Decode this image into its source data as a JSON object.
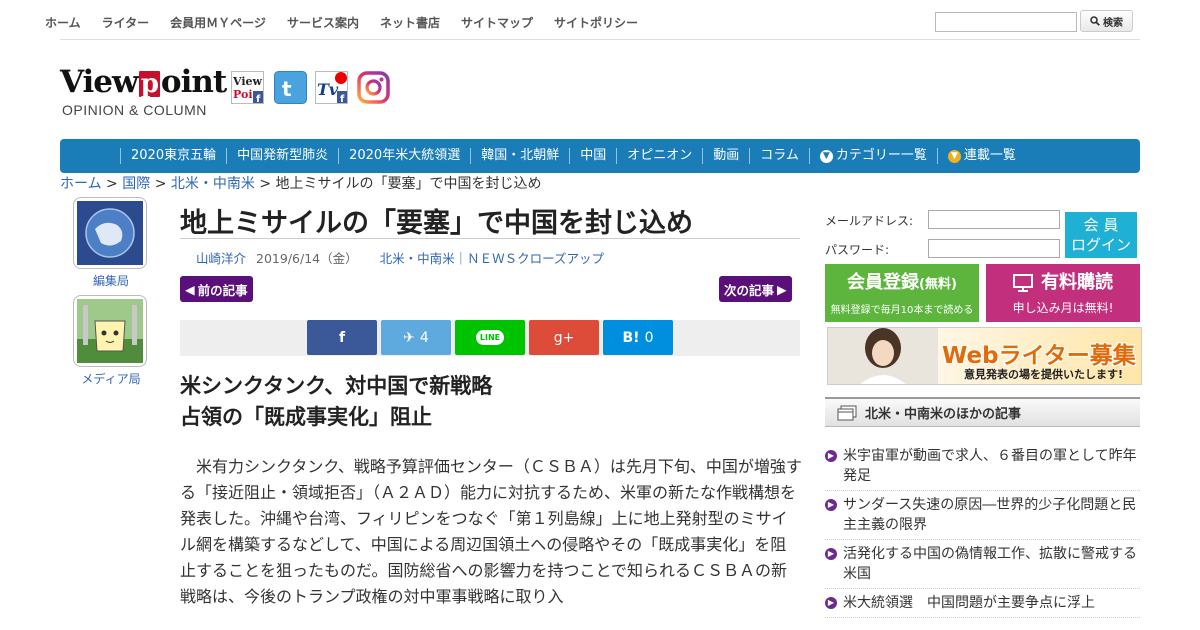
{
  "top_nav": {
    "links": [
      "ホーム",
      "ライター",
      "会員用ＭＹページ",
      "サービス案内",
      "ネット書店",
      "サイトマップ",
      "サイトポリシー"
    ],
    "search_placeholder": "",
    "search_button": "検索"
  },
  "logo": {
    "word_before": "View",
    "word_p": "p",
    "word_after": "oint",
    "sub": "OPINION & COLUMN"
  },
  "social_icons": [
    "viewpoint-facebook-icon",
    "twitter-icon",
    "viewpoint-tv-icon",
    "instagram-icon"
  ],
  "main_nav": {
    "items": [
      "2020東京五輪",
      "中国発新型肺炎",
      "2020年米大統領選",
      "韓国・北朝鮮",
      "中国",
      "オピニオン",
      "動画",
      "コラム"
    ],
    "category_list": "カテゴリー一覧",
    "series_list": "連載一覧"
  },
  "breadcrumb": {
    "home": "ホーム",
    "international": "国際",
    "region": "北米・中南米",
    "current": "地上ミサイルの「要塞」で中国を封じ込め",
    "sep": ">"
  },
  "left_boxes": {
    "editorial": "編集局",
    "media": "メディア局"
  },
  "article": {
    "title": "地上ミサイルの「要塞」で中国を封じ込め",
    "author": "山崎洋介",
    "date": "2019/6/14（金）",
    "categories": "北米・中南米｜ＮＥＷＳクローズアップ",
    "prev": "前の記事",
    "next": "次の記事",
    "subtitle_1": "米シンクタンク、対中国で新戦略",
    "subtitle_2": "占領の「既成事実化」阻止",
    "body": "米有力シンクタンク、戦略予算評価センター（ＣＳＢＡ）は先月下旬、中国が増強する「接近阻止・領域拒否」（Ａ２ＡＤ）能力に対抗するため、米軍の新たな作戦構想を発表した。沖縄や台湾、フィリピンをつなぐ「第１列島線」上に地上発射型のミサイル網を構築するなどして、中国による周辺国領土への侵略やその「既成事実化」を阻止することを狙ったものだ。国防総省への影響力を持つことで知られるＣＳＢＡの新戦略は、今後のトランプ政権の対中軍事戦略に取り入"
  },
  "share": {
    "facebook": "f",
    "twitter_count": "4",
    "line": "LINE",
    "gplus": "g+",
    "hatena": "B!",
    "hatena_count": "0",
    "colors": {
      "facebook": "#3b5998",
      "twitter": "#5ea9dd",
      "line": "#00c300",
      "gplus": "#dd4b39",
      "hatena": "#008fde"
    }
  },
  "login": {
    "email_label": "メールアドレス:",
    "password_label": "パスワード:",
    "button_1": "会 員",
    "button_2": "ログイン"
  },
  "register": {
    "title": "会員登録",
    "title_small": "(無料)",
    "sub": "無料登録で毎月10本まで読める"
  },
  "purchase": {
    "title": "有料購読",
    "sub": "申し込み月は無料!"
  },
  "banner": {
    "title": "Webライター募集",
    "sub": "意見発表の場を提供いたします!"
  },
  "other_articles": {
    "heading": "北米・中南米のほかの記事",
    "items": [
      "米宇宙軍が動画で求人、６番目の軍として昨年発足",
      "サンダース失速の原因―世界的少子化問題と民主主義の限界",
      "活発化する中国の偽情報工作、拡散に警戒する米国",
      "米大統領選　中国問題が主要争点に浮上"
    ]
  },
  "colors": {
    "nav_blue": "#1a7db8",
    "link_blue": "#2f66b3",
    "purple": "#5a0f7a"
  }
}
